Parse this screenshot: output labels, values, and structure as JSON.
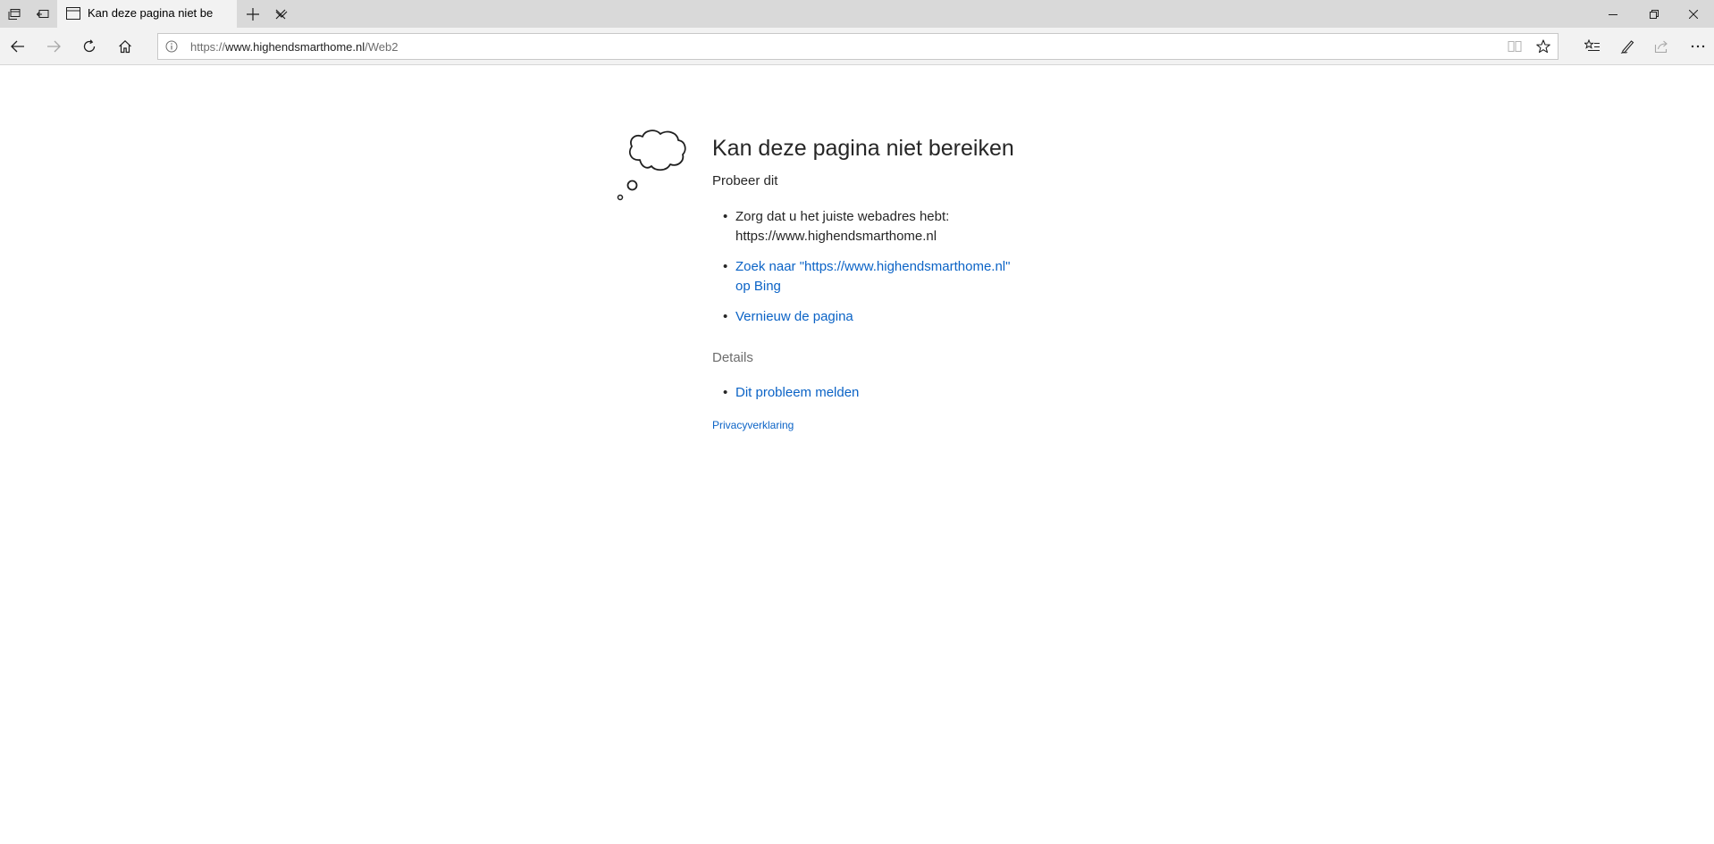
{
  "browser": {
    "tab": {
      "title": "Kan deze pagina niet be"
    },
    "address_bar": {
      "url_scheme": "https://",
      "url_host": "www.highendsmarthome.nl",
      "url_path": "/Web2"
    },
    "icons": {
      "tab_manager": "tab-manager-icon",
      "set_tabs_aside": "set-aside-icon",
      "tab_favicon": "page-icon",
      "tab_close": "close-icon",
      "new_tab": "plus-icon",
      "tab_preview": "chevron-down-icon",
      "minimize": "minimize-icon",
      "restore": "restore-icon",
      "window_close": "close-icon",
      "back": "arrow-left-icon",
      "forward": "arrow-right-icon",
      "refresh": "refresh-icon",
      "home": "home-icon",
      "site_info": "info-icon",
      "reading_view": "book-icon",
      "favorite": "star-icon",
      "favorites_hub": "favorites-list-icon",
      "web_notes": "pen-icon",
      "share": "share-icon",
      "more": "ellipsis-icon"
    }
  },
  "error_page": {
    "title": "Kan deze pagina niet bereiken",
    "try_heading": "Probeer dit",
    "suggestion_check_address": "Zorg dat u het juiste webadres hebt: https://www.highendsmarthome.nl",
    "suggestion_search": "Zoek naar \"https://www.highendsmarthome.nl\" op Bing",
    "suggestion_refresh": "Vernieuw de pagina",
    "details_heading": "Details",
    "report_problem": "Dit probleem melden",
    "privacy_link": "Privacyverklaring",
    "illustration": "thought-cloud-icon"
  }
}
